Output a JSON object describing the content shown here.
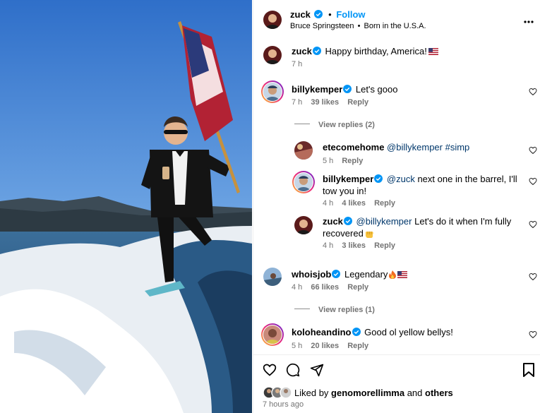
{
  "post": {
    "author": "zuck",
    "follow_label": "Follow",
    "dot": "•",
    "audio_artist": "Bruce Springsteen",
    "audio_track": "Born in the U.S.A.",
    "audio_sep": "•",
    "caption": "Happy birthday, America!",
    "caption_time": "7 h",
    "more_icon": "more-horizontal-icon"
  },
  "comments": [
    {
      "user": "billykemper",
      "text": "Let's gooo",
      "time": "7 h",
      "likes": "39 likes",
      "reply": "Reply",
      "view_replies": "View replies (2)"
    },
    {
      "user": "etecomehome",
      "mention": "@billykemper #simp",
      "time": "5 h",
      "reply": "Reply"
    },
    {
      "user": "billykemper",
      "mention": "@zuck",
      "text": "next one in the barrel, I'll tow you in!",
      "time": "4 h",
      "likes": "4 likes",
      "reply": "Reply"
    },
    {
      "user": "zuck",
      "mention": "@billykemper",
      "text": "Let's do it when I'm fully recovered",
      "time": "4 h",
      "likes": "3 likes",
      "reply": "Reply"
    },
    {
      "user": "whoisjob",
      "text": "Legendary",
      "time": "4 h",
      "likes": "66 likes",
      "reply": "Reply",
      "view_replies": "View replies (1)"
    },
    {
      "user": "koloheandino",
      "text": "Good ol yellow bellys!",
      "time": "5 h",
      "likes": "20 likes",
      "reply": "Reply"
    }
  ],
  "footer": {
    "liked_by_prefix": "Liked by",
    "liked_by_user": "genomorellimma",
    "liked_by_and": "and",
    "liked_by_others": "others",
    "timestamp": "7 hours ago"
  },
  "colors": {
    "accent": "#0095f6",
    "verified": "#0095f6",
    "meta": "#737373",
    "link": "#00376b"
  }
}
